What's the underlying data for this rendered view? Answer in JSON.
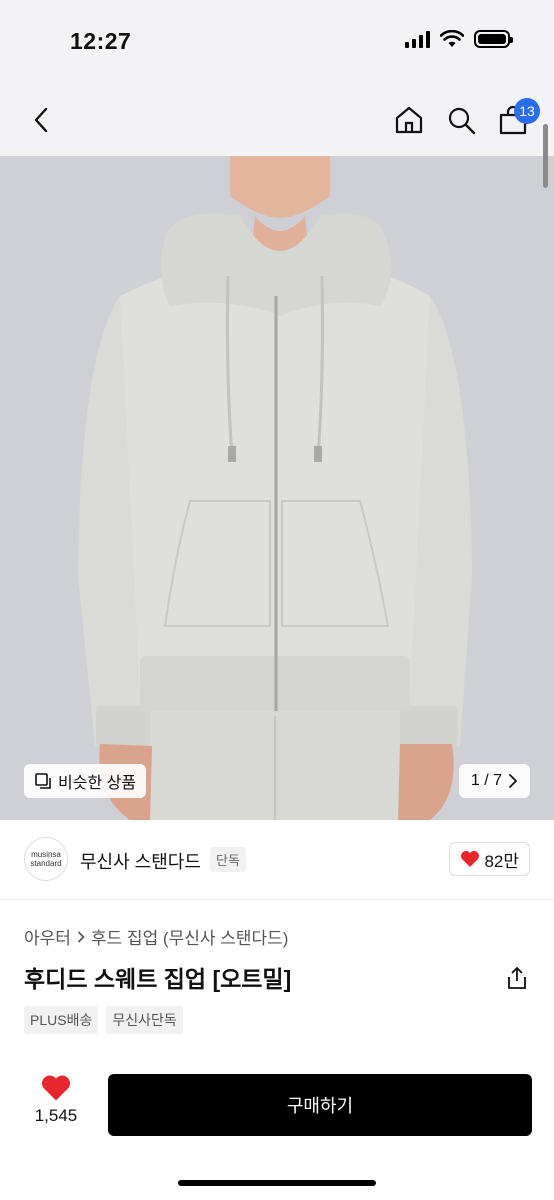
{
  "status_bar": {
    "time": "12:27"
  },
  "nav": {
    "cart_count": "13"
  },
  "hero": {
    "similar_label": "비슷한 상품",
    "page_counter": "1 / 7"
  },
  "brand": {
    "logo_line1": "musinsa",
    "logo_line2": "standard",
    "name": "무신사 스탠다드",
    "badge": "단독",
    "likes": "82만"
  },
  "product": {
    "breadcrumb": [
      "아우터",
      "후드 집업 (무신사 스탠다드)"
    ],
    "title": "후디드 스웨트 집업 [오트밀]",
    "tags": [
      "PLUS배송",
      "무신사단독"
    ]
  },
  "bottom_bar": {
    "like_count": "1,545",
    "buy_label": "구매하기"
  },
  "colors": {
    "accent_blue": "#2c6df0",
    "heart_red": "#e8262d",
    "hoodie": "#dcdcd8",
    "backdrop": "#cfd0d6"
  }
}
